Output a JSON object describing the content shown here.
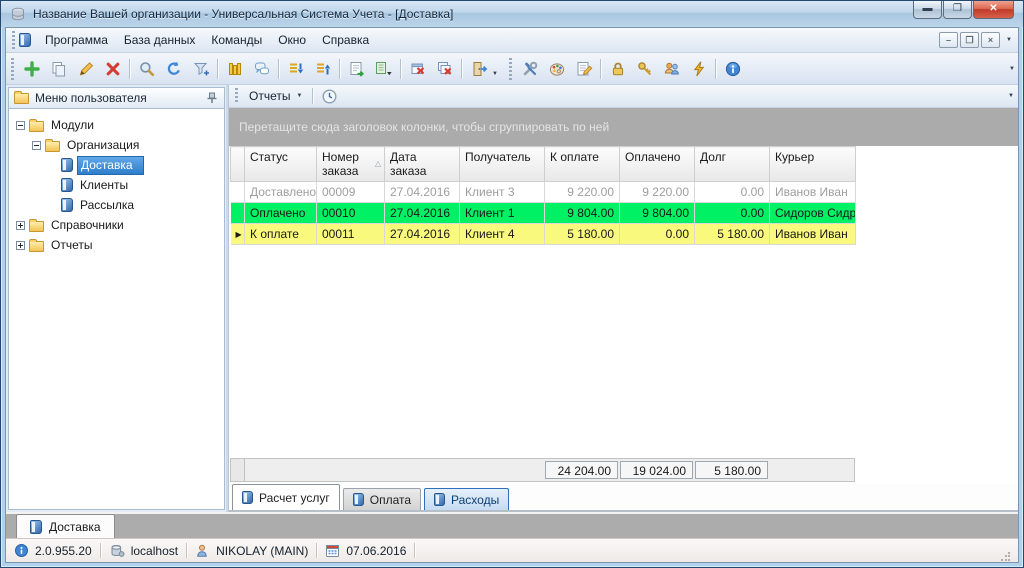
{
  "window": {
    "title": "Название Вашей организации - Универсальная Система Учета - [Доставка]",
    "controls": [
      "minimize-icon",
      "maximize-icon",
      "close-icon"
    ]
  },
  "menubar": {
    "items": [
      "Программа",
      "База данных",
      "Команды",
      "Окно",
      "Справка"
    ],
    "mdi_controls": [
      "minimize-icon",
      "restore-icon",
      "close-icon"
    ]
  },
  "toolbar": {
    "icons": [
      "add-icon",
      "copy-icon",
      "edit-icon",
      "delete-icon",
      "search-icon",
      "refresh-icon",
      "filter-icon",
      "columns-icon",
      "comments-icon",
      "expand-all-icon",
      "collapse-all-icon",
      "export-excel-icon",
      "export-excel-menu-icon",
      "close-window-icon",
      "close-all-windows-icon",
      "exit-icon",
      "settings-icon",
      "appearance-icon",
      "report-designer-icon",
      "lock-icon",
      "access-key-icon",
      "users-icon",
      "connection-icon",
      "about-icon"
    ]
  },
  "sidebar": {
    "title": "Меню пользователя",
    "tree": [
      {
        "label": "Модули",
        "level": 0,
        "type": "folder",
        "expanded": true
      },
      {
        "label": "Организация",
        "level": 1,
        "type": "folder",
        "expanded": true
      },
      {
        "label": "Доставка",
        "level": 2,
        "type": "item",
        "selected": true
      },
      {
        "label": "Клиенты",
        "level": 2,
        "type": "item",
        "selected": false
      },
      {
        "label": "Рассылка",
        "level": 2,
        "type": "item",
        "selected": false
      },
      {
        "label": "Справочники",
        "level": 0,
        "type": "folder",
        "expanded": false
      },
      {
        "label": "Отчеты",
        "level": 0,
        "type": "folder",
        "expanded": false
      }
    ]
  },
  "reports_bar": {
    "button": "Отчеты",
    "icons": [
      "clock-icon"
    ]
  },
  "grid": {
    "group_hint": "Перетащите сюда заголовок колонки, чтобы сгруппировать по ней",
    "columns": [
      "Статус",
      "Номер заказа",
      "Дата заказа",
      "Получатель",
      "К оплате",
      "Оплачено",
      "Долг",
      "Курьер"
    ],
    "sorted_column": "Номер заказа",
    "sort_direction": "asc",
    "rows": [
      {
        "status": "Доставлено",
        "number": "00009",
        "date": "27.04.2016",
        "recipient": "Клиент 3",
        "to_pay": "9 220.00",
        "paid": "9 220.00",
        "debt": "0.00",
        "courier": "Иванов Иван",
        "highlight": "none"
      },
      {
        "status": "Оплачено",
        "number": "00010",
        "date": "27.04.2016",
        "recipient": "Клиент 1",
        "to_pay": "9 804.00",
        "paid": "9 804.00",
        "debt": "0.00",
        "courier": "Сидоров Сидр",
        "highlight": "green"
      },
      {
        "status": "К оплате",
        "number": "00011",
        "date": "27.04.2016",
        "recipient": "Клиент 4",
        "to_pay": "5 180.00",
        "paid": "0.00",
        "debt": "5 180.00",
        "courier": "Иванов Иван",
        "highlight": "yellow",
        "focused": true
      }
    ],
    "summary": {
      "to_pay": "24 204.00",
      "paid": "19 024.00",
      "debt": "5 180.00"
    }
  },
  "bottom_tabs": [
    {
      "label": "Расчет услуг",
      "state": "active"
    },
    {
      "label": "Оплата",
      "state": "normal"
    },
    {
      "label": "Расходы",
      "state": "hot"
    }
  ],
  "mdi_tabs": [
    {
      "label": "Доставка"
    }
  ],
  "statusbar": {
    "panels": [
      {
        "icon": "info-icon",
        "text": "2.0.955.20"
      },
      {
        "icon": "database-icon",
        "text": "localhost"
      },
      {
        "icon": "user-icon",
        "text": "NIKOLAY (MAIN)"
      },
      {
        "icon": "calendar-icon",
        "text": "07.06.2016"
      }
    ]
  },
  "colors": {
    "row_paid_green": "#00F163",
    "row_due_yellow": "#F9F97D",
    "selection_blue": "#3C8FE0",
    "group_bar_gray": "#ABABAB",
    "titlebar_blue": "#BED5EA",
    "close_button_red": "#C0392A"
  }
}
